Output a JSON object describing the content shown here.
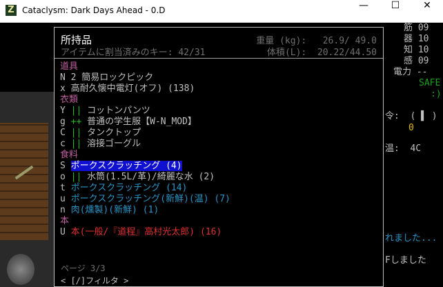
{
  "window": {
    "title": "Cataclysm: Dark Days Ahead - 0.D",
    "icon_letter": "Z",
    "controls": {
      "minimize": "—",
      "maximize": "☐",
      "close": "✕"
    }
  },
  "inventory": {
    "title": "所持品",
    "assigned_keys": "アイテムに割当済みのキー: 42/31",
    "weight": "重量 (kg):   26.9/ 49.0",
    "volume": "体積(L):  20.22/44.50",
    "rows": [
      {
        "type": "cat",
        "text": "道具"
      },
      {
        "type": "item",
        "key": "N",
        "mark": " ",
        "name": "2 簡易ロックピック",
        "color": "#c0c0c0"
      },
      {
        "type": "item",
        "key": "x",
        "mark": " ",
        "name": "高耐久懐中電灯(オフ) (138)",
        "color": "#c0c0c0"
      },
      {
        "type": "cat",
        "text": "衣類"
      },
      {
        "type": "item",
        "key": "Y",
        "mark": "||",
        "name": "コットンパンツ",
        "color": "#c0c0c0"
      },
      {
        "type": "item",
        "key": "g",
        "mark": "++",
        "name": "普通の学生服【W-N_MOD】",
        "color": "#c0c0c0"
      },
      {
        "type": "item",
        "key": "C",
        "mark": "||",
        "name": "タンクトップ",
        "color": "#c0c0c0"
      },
      {
        "type": "item",
        "key": "c",
        "mark": "||",
        "name": "溶接ゴーグル",
        "color": "#c0c0c0"
      },
      {
        "type": "cat",
        "text": "食料"
      },
      {
        "type": "item",
        "key": "S",
        "mark": "",
        "name": "ポークスクラッチング (4)",
        "color": "#ffffff",
        "selected": true
      },
      {
        "type": "item",
        "key": "o",
        "mark": "||",
        "name": "水筒(1.5L/革)/綺麗な水 (2)",
        "color": "#c0c0c0"
      },
      {
        "type": "item",
        "key": "t",
        "mark": "",
        "name": "ポークスクラッチング (14)",
        "color": "#2a96c8"
      },
      {
        "type": "item",
        "key": "u",
        "mark": "",
        "name": "ポークスクラッチング(新鮮)(温) (7)",
        "color": "#2a96c8"
      },
      {
        "type": "item",
        "key": "n",
        "mark": "",
        "name": "肉(燻製)(新鮮) (1)",
        "color": "#2a96c8"
      },
      {
        "type": "cat",
        "text": "本"
      },
      {
        "type": "item",
        "key": "U",
        "mark": "",
        "name": "本(一般/『道程』高村光太郎) (16)",
        "color": "#e03030"
      }
    ],
    "page": "ページ 3/3",
    "filter": "< [/]フィルタ >"
  },
  "sidebar": [
    {
      "text": "筋",
      "value": "09"
    },
    {
      "text": "器",
      "value": "10"
    },
    {
      "text": "知",
      "value": "10"
    },
    {
      "text": "感",
      "value": "09"
    },
    {
      "text": "電力",
      "value": "--"
    }
  ],
  "sidebar_misc": {
    "safe": "SAFE",
    "smiley": ":)",
    "row1": "令:  ( ▌ )",
    "row2": "0",
    "row3": "温:  4C",
    "msg1": "れました...",
    "msg2": "Fしました"
  },
  "colors": {
    "category": "#c060a0",
    "mark_green": "#20c020",
    "key": "#c0c0c0"
  }
}
